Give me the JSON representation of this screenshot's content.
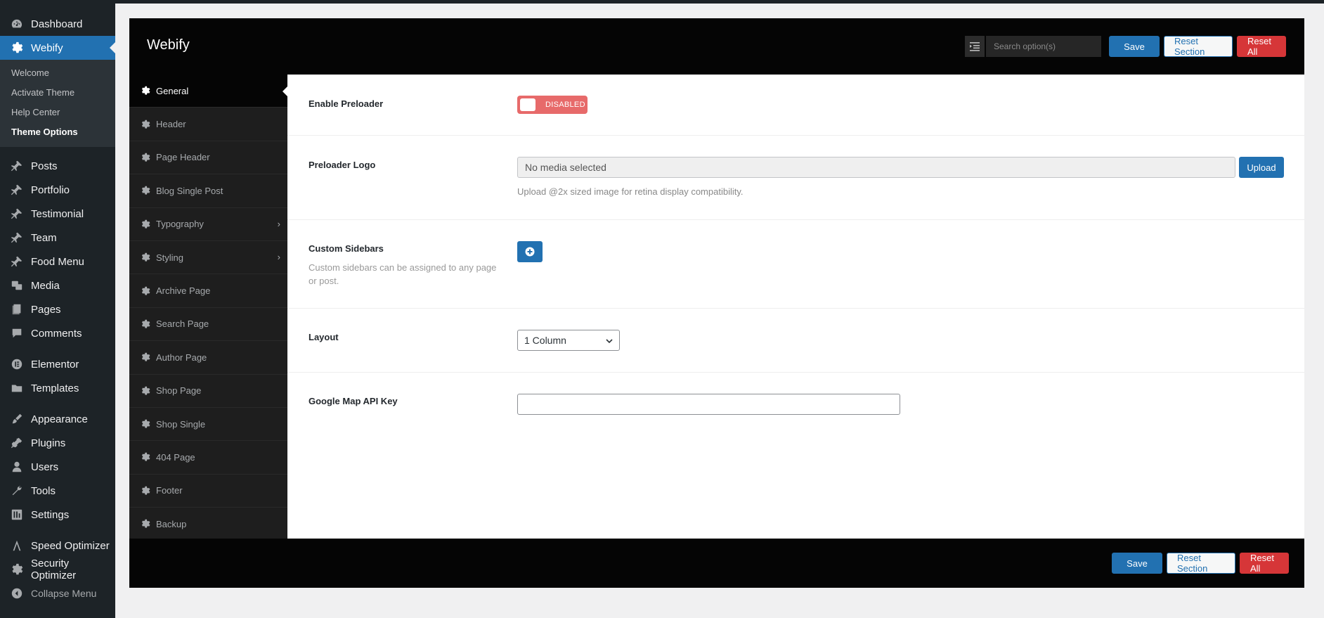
{
  "wp_sidebar": {
    "items_top": [
      {
        "label": "Dashboard",
        "icon": "dashboard-icon"
      }
    ],
    "active": {
      "label": "Webify",
      "icon": "gear-icon"
    },
    "submenu": [
      "Welcome",
      "Activate Theme",
      "Help Center",
      "Theme Options"
    ],
    "submenu_current": "Theme Options",
    "group1": [
      {
        "label": "Posts",
        "icon": "pin-icon"
      },
      {
        "label": "Portfolio",
        "icon": "pin-icon"
      },
      {
        "label": "Testimonial",
        "icon": "pin-icon"
      },
      {
        "label": "Team",
        "icon": "pin-icon"
      },
      {
        "label": "Food Menu",
        "icon": "pin-icon"
      },
      {
        "label": "Media",
        "icon": "media-icon"
      },
      {
        "label": "Pages",
        "icon": "pages-icon"
      },
      {
        "label": "Comments",
        "icon": "comment-icon"
      }
    ],
    "group2": [
      {
        "label": "Elementor",
        "icon": "elementor-icon"
      },
      {
        "label": "Templates",
        "icon": "folder-icon"
      }
    ],
    "group3": [
      {
        "label": "Appearance",
        "icon": "brush-icon"
      },
      {
        "label": "Plugins",
        "icon": "plug-icon"
      },
      {
        "label": "Users",
        "icon": "user-icon"
      },
      {
        "label": "Tools",
        "icon": "wrench-icon"
      },
      {
        "label": "Settings",
        "icon": "settings-icon"
      }
    ],
    "group4": [
      {
        "label": "Speed Optimizer",
        "icon": "speed-icon"
      },
      {
        "label": "Security Optimizer",
        "icon": "gear-icon"
      }
    ],
    "collapse_label": "Collapse Menu"
  },
  "panel": {
    "brand": "Webify",
    "search_placeholder": "Search option(s)",
    "save_label": "Save",
    "reset_section_label": "Reset Section",
    "reset_all_label": "Reset All"
  },
  "section_nav": [
    {
      "label": "General",
      "active": true,
      "has_children": false
    },
    {
      "label": "Header",
      "active": false,
      "has_children": false
    },
    {
      "label": "Page Header",
      "active": false,
      "has_children": false
    },
    {
      "label": "Blog Single Post",
      "active": false,
      "has_children": false
    },
    {
      "label": "Typography",
      "active": false,
      "has_children": true
    },
    {
      "label": "Styling",
      "active": false,
      "has_children": true
    },
    {
      "label": "Archive Page",
      "active": false,
      "has_children": false
    },
    {
      "label": "Search Page",
      "active": false,
      "has_children": false
    },
    {
      "label": "Author Page",
      "active": false,
      "has_children": false
    },
    {
      "label": "Shop Page",
      "active": false,
      "has_children": false
    },
    {
      "label": "Shop Single",
      "active": false,
      "has_children": false
    },
    {
      "label": "404 Page",
      "active": false,
      "has_children": false
    },
    {
      "label": "Footer",
      "active": false,
      "has_children": false
    },
    {
      "label": "Backup",
      "active": false,
      "has_children": false
    }
  ],
  "fields": {
    "preloader": {
      "label": "Enable Preloader",
      "state": "DISABLED"
    },
    "preloader_logo": {
      "label": "Preloader Logo",
      "value": "No media selected",
      "upload_label": "Upload",
      "desc": "Upload @2x sized image for retina display compatibility."
    },
    "custom_sidebars": {
      "label": "Custom Sidebars",
      "desc": "Custom sidebars can be assigned to any page or post."
    },
    "layout": {
      "label": "Layout",
      "value": "1 Column"
    },
    "google_map": {
      "label": "Google Map API Key",
      "value": ""
    }
  },
  "colors": {
    "primary": "#2271b1",
    "danger": "#d63638",
    "switch_off": "#e76a6a",
    "panel_dark": "#050505"
  }
}
